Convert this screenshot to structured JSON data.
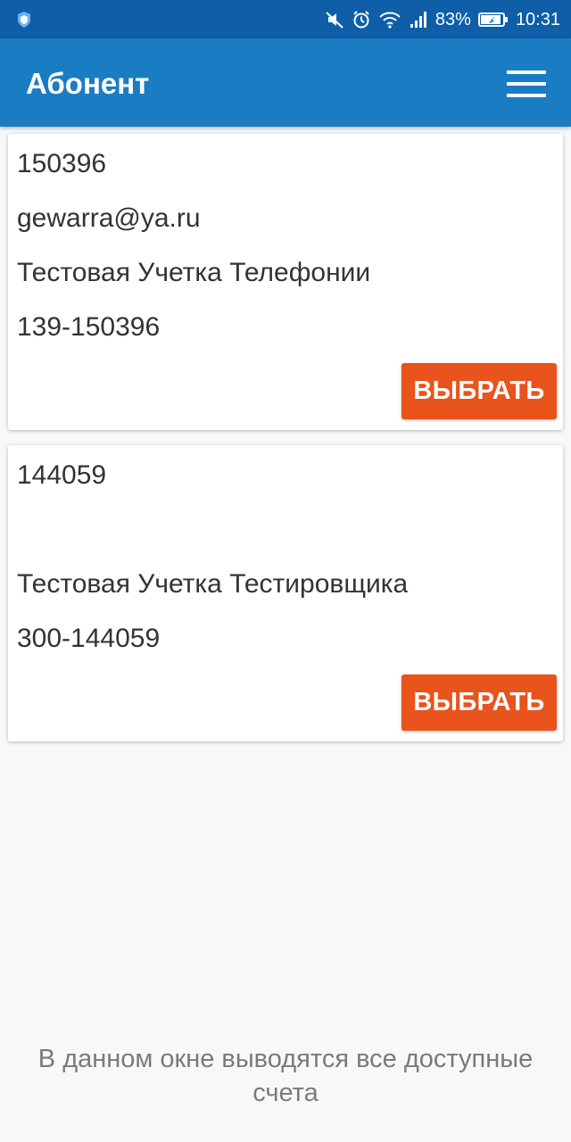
{
  "status_bar": {
    "battery": "83%",
    "time": "10:31",
    "icons": [
      "shield-icon",
      "mute-icon",
      "alarm-icon",
      "wifi-icon",
      "signal-icon",
      "battery-icon"
    ]
  },
  "app_bar": {
    "title": "Абонент",
    "menu_icon": "hamburger-menu-icon"
  },
  "accounts": [
    {
      "number": "150396",
      "email": "gewarra@ya.ru",
      "name": "Тестовая Учетка Телефонии",
      "code": "139-150396",
      "button_label": "ВЫБРАТЬ"
    },
    {
      "number": "144059",
      "email": "",
      "name": "Тестовая Учетка Тестировщика",
      "code": "300-144059",
      "button_label": "ВЫБРАТЬ"
    }
  ],
  "footer": {
    "note": "В данном окне выводятся все доступные счета"
  },
  "colors": {
    "status_bar": "#0e5ea8",
    "app_bar": "#1a7dc4",
    "accent_button": "#e8541c",
    "background": "#f8f8f8"
  }
}
